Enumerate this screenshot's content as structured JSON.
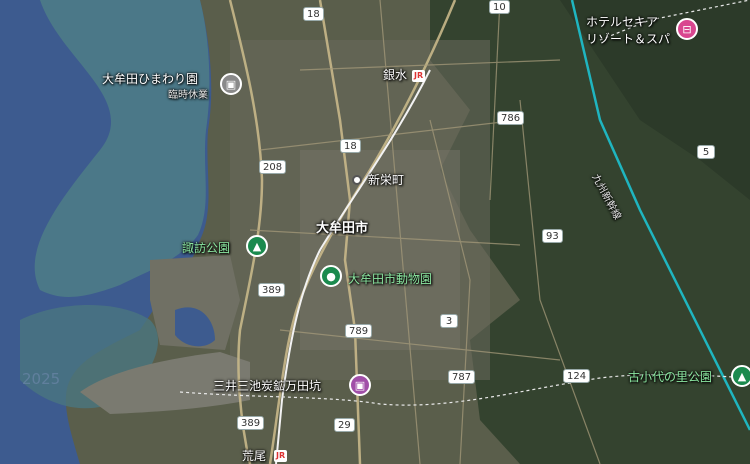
{
  "places": {
    "himawari": {
      "name": "大牟田ひまわり園",
      "note": "臨時休業"
    },
    "hotel": {
      "line1": "ホテルセキア",
      "line2": "リゾート＆スパ"
    },
    "ginsui": "銀水",
    "shineimachi": "新栄町",
    "omuta_city": "大牟田市",
    "suwa_park": "諏訪公園",
    "zoo": "大牟田市動物園",
    "mine": "三井三池炭鉱万田坑",
    "kogoshiro": "古小代の里公園",
    "arao": "荒尾",
    "shinkansen": "九州新幹線",
    "watermark": "2025"
  },
  "routes": [
    "18",
    "10",
    "786",
    "5",
    "18",
    "208",
    "93",
    "389",
    "3",
    "789",
    "787",
    "124",
    "389",
    "29"
  ],
  "jr_badge": "JR",
  "icons": {
    "himawari": "facility-icon",
    "hotel": "hotel-bed-icon",
    "suwa_park": "park-tree-icon",
    "zoo": "zoo-paw-icon",
    "mine": "museum-icon",
    "kogoshiro": "park-tree-icon"
  },
  "colors": {
    "sea": "#3d5b8f",
    "coast": "#4f7f86",
    "land": "#5a5e4b",
    "forest": "#2f3f2c",
    "rail": "#1fb5c0",
    "road": "#c8b88a"
  }
}
